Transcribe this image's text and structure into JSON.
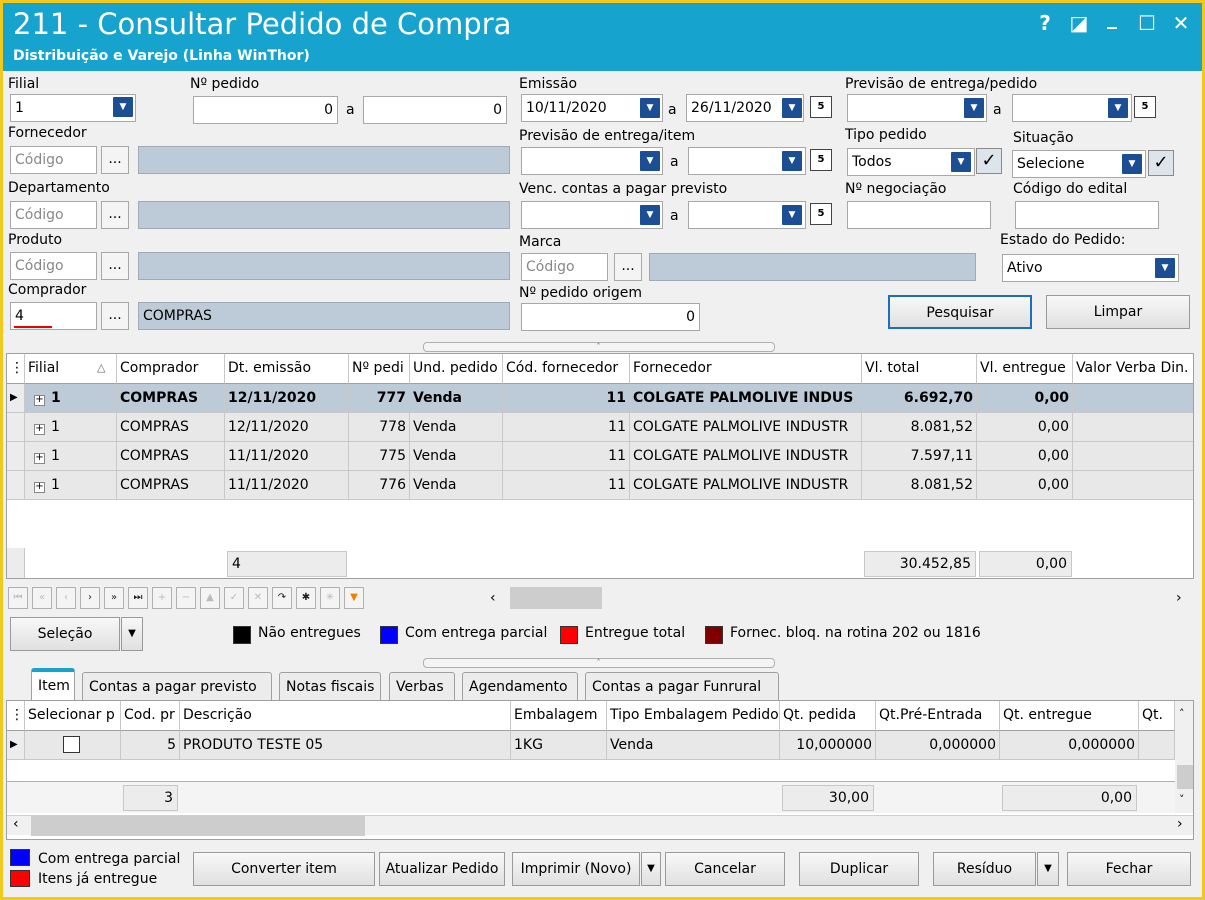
{
  "window": {
    "title": "211 - Consultar Pedido de Compra",
    "subtitle": "Distribuição e Varejo (Linha WinThor)",
    "help": "?",
    "restore": "◪",
    "minimize": "_",
    "maximize": "☐",
    "close": "✕"
  },
  "filters": {
    "filial_label": "Filial",
    "filial_value": "1",
    "pedido_label": "Nº pedido",
    "pedido_from": "0",
    "pedido_to": "0",
    "a": "a",
    "emissao_label": "Emissão",
    "emissao_from": "10/11/2020",
    "emissao_to": "26/11/2020",
    "prev_pedido_label": "Previsão de entrega/pedido",
    "fornecedor_label": "Fornecedor",
    "codigo_ph": "Código",
    "prev_item_label": "Previsão de entrega/item",
    "tipo_pedido_label": "Tipo pedido",
    "tipo_pedido_value": "Todos",
    "situacao_label": "Situação",
    "situacao_value": "Selecione",
    "departamento_label": "Departamento",
    "venc_label": "Venc. contas a  pagar previsto",
    "negociacao_label": "Nº negociação",
    "edital_label": "Código do edital",
    "produto_label": "Produto",
    "marca_label": "Marca",
    "estado_label": "Estado do Pedido:",
    "estado_value": "Ativo",
    "comprador_label": "Comprador",
    "comprador_code": "4",
    "comprador_name": "COMPRAS",
    "origem_label": "Nº pedido origem",
    "origem_value": "0",
    "dots": "..."
  },
  "buttons": {
    "pesquisar": "Pesquisar",
    "limpar": "Limpar",
    "selecao": "Seleção",
    "converter": "Converter item",
    "atualizar": "Atualizar Pedido",
    "imprimir": "Imprimir (Novo)",
    "cancelar": "Cancelar",
    "duplicar": "Duplicar",
    "residuo": "Resíduo",
    "fechar": "Fechar"
  },
  "orders": {
    "headers": [
      "Filial",
      "Comprador",
      "Dt. emissão",
      "Nº pedi",
      "Und. pedido",
      "Cód. fornecedor",
      "Fornecedor",
      "Vl. total",
      "Vl. entregue",
      "Valor Verba Din."
    ],
    "rows": [
      {
        "filial": "1",
        "comprador": "COMPRAS",
        "dt": "12/11/2020",
        "num": "777",
        "und": "Venda",
        "cod": "11",
        "forn": "COLGATE PALMOLIVE INDUS",
        "total": "6.692,70",
        "entregue": "0,00"
      },
      {
        "filial": "1",
        "comprador": "COMPRAS",
        "dt": "12/11/2020",
        "num": "778",
        "und": "Venda",
        "cod": "11",
        "forn": "COLGATE PALMOLIVE INDUSTR",
        "total": "8.081,52",
        "entregue": "0,00"
      },
      {
        "filial": "1",
        "comprador": "COMPRAS",
        "dt": "11/11/2020",
        "num": "775",
        "und": "Venda",
        "cod": "11",
        "forn": "COLGATE PALMOLIVE INDUSTR",
        "total": "7.597,11",
        "entregue": "0,00"
      },
      {
        "filial": "1",
        "comprador": "COMPRAS",
        "dt": "11/11/2020",
        "num": "776",
        "und": "Venda",
        "cod": "11",
        "forn": "COLGATE PALMOLIVE INDUSTR",
        "total": "8.081,52",
        "entregue": "0,00"
      }
    ],
    "footer_count": "4",
    "footer_total": "30.452,85",
    "footer_entregue": "0,00"
  },
  "legend": [
    {
      "label": "Não entregues",
      "color": "#000000"
    },
    {
      "label": "Com entrega parcial",
      "color": "#0000ff"
    },
    {
      "label": "Entregue total",
      "color": "#ff0000"
    },
    {
      "label": "Fornec. bloq. na rotina 202 ou 1816",
      "color": "#800000"
    }
  ],
  "tabs": [
    "Item",
    "Contas a pagar previsto",
    "Notas fiscais",
    "Verbas",
    "Agendamento",
    "Contas a pagar Funrural"
  ],
  "items": {
    "headers": [
      "Selecionar p",
      "Cod. pr",
      "Descrição",
      "Embalagem",
      "Tipo Embalagem Pedido",
      "Qt. pedida",
      "Qt.Pré-Entrada",
      "Qt. entregue",
      "Qt."
    ],
    "row": {
      "cod": "5",
      "desc": "PRODUTO TESTE 05",
      "emb": "1KG",
      "tipo": "Venda",
      "qt_pedida": "10,000000",
      "qt_pre": "0,000000",
      "qt_entregue": "0,000000"
    },
    "footer_count": "3",
    "footer_qt": "30,00",
    "footer_ent": "0,00"
  },
  "bottom_legend": [
    {
      "label": "Com entrega parcial",
      "color": "#0000ff"
    },
    {
      "label": "Itens já entregue",
      "color": "#ff0000"
    }
  ],
  "nav_icons": [
    "first-icon",
    "prev-page-icon",
    "prev-icon",
    "next-icon",
    "next-page-icon",
    "last-icon",
    "insert-icon",
    "delete-icon",
    "edit-icon",
    "post-icon",
    "cancel-icon",
    "refresh-icon",
    "asterisk-icon",
    "filter-clear-icon",
    "filter-icon"
  ]
}
